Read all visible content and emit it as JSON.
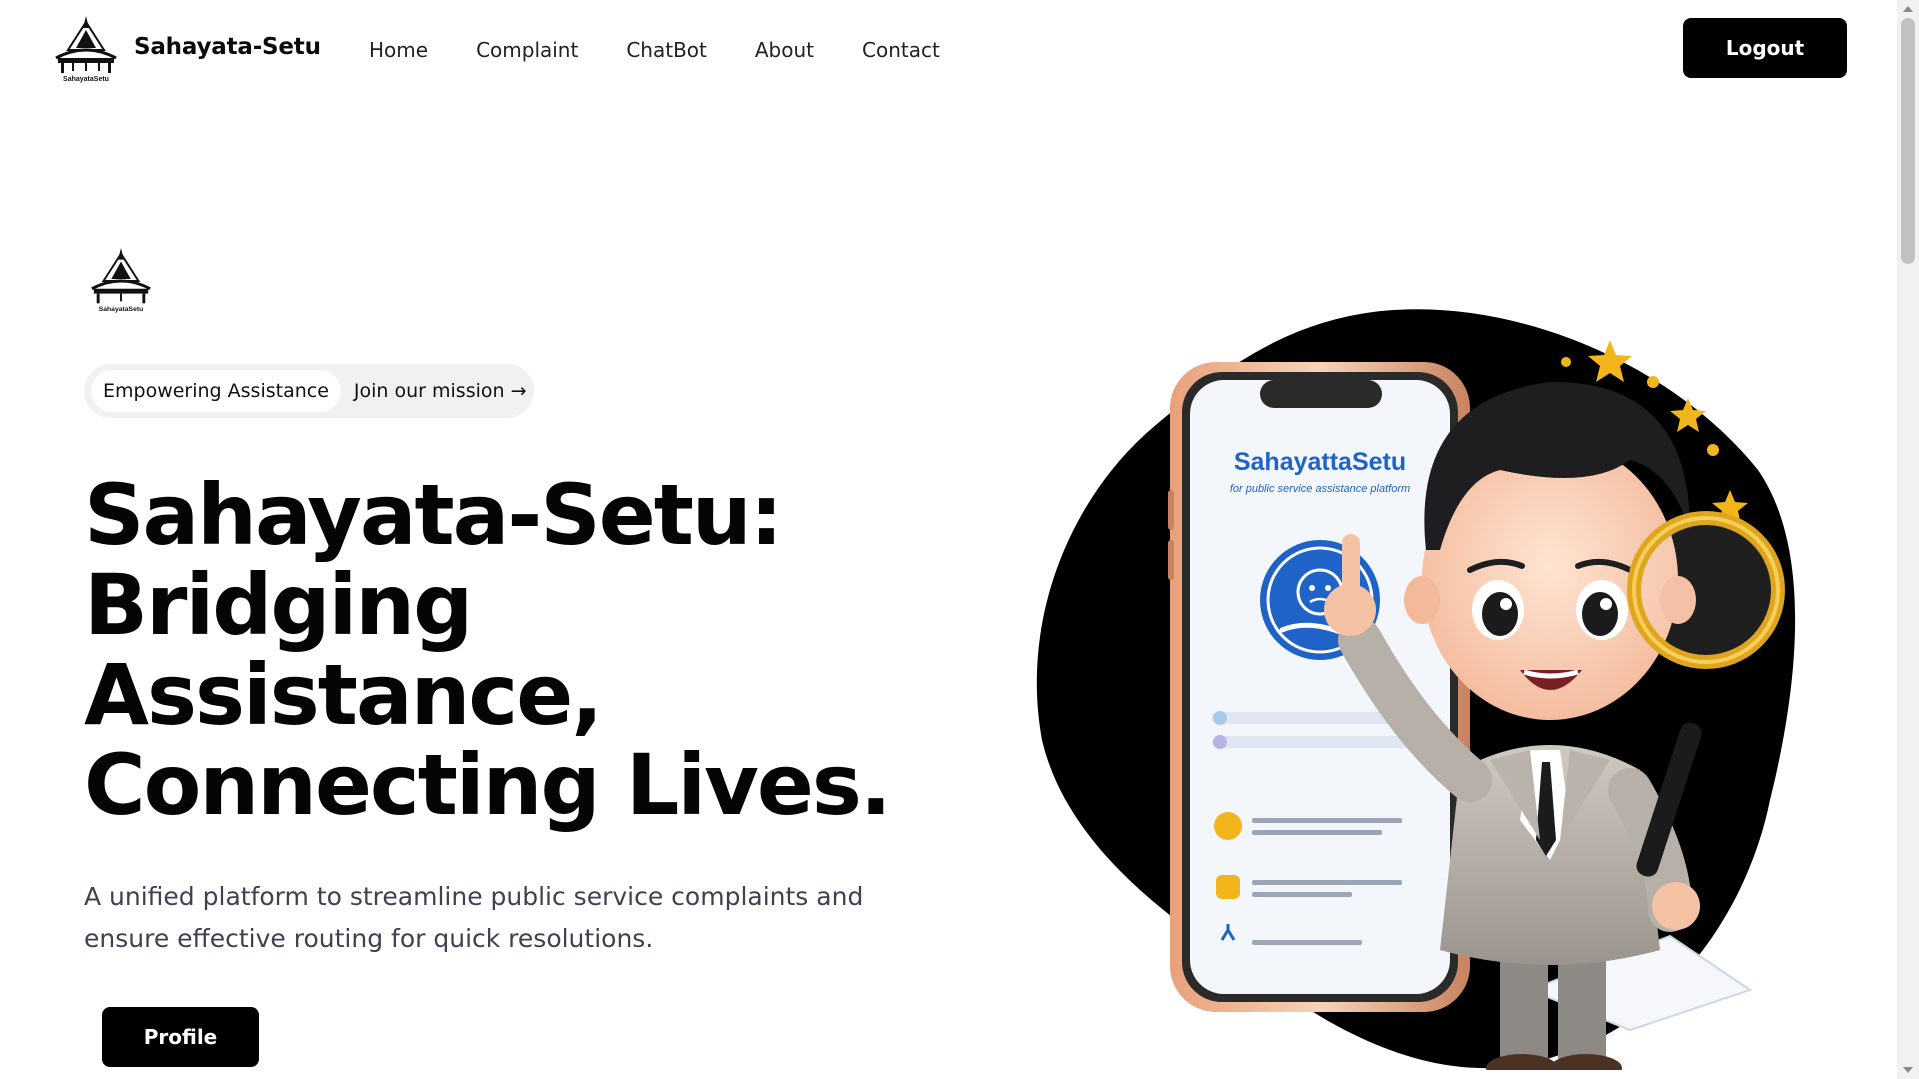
{
  "header": {
    "brand_name": "Sahayata-Setu",
    "logo_caption": "SahayataSetu",
    "nav": [
      {
        "label": "Home"
      },
      {
        "label": "Complaint"
      },
      {
        "label": "ChatBot"
      },
      {
        "label": "About"
      },
      {
        "label": "Contact"
      }
    ],
    "logout_label": "Logout"
  },
  "hero": {
    "badge_tag": "Empowering Assistance",
    "badge_link": "Join our mission →",
    "title_lines": [
      "Sahayata-Setu:",
      "Bridging",
      "Assistance,",
      "Connecting Lives."
    ],
    "description": "A unified platform to streamline public service complaints and ensure effective routing for quick resolutions.",
    "profile_label": "Profile"
  },
  "illustration": {
    "app_title": "SahayattaSetu",
    "app_subtitle": "for public service assistance platform"
  },
  "colors": {
    "primary": "#000000",
    "text_muted": "#3c4250",
    "pill_bg": "#f1f1f3",
    "accent_blue": "#1f63c8",
    "star_gold": "#f2b51c"
  }
}
